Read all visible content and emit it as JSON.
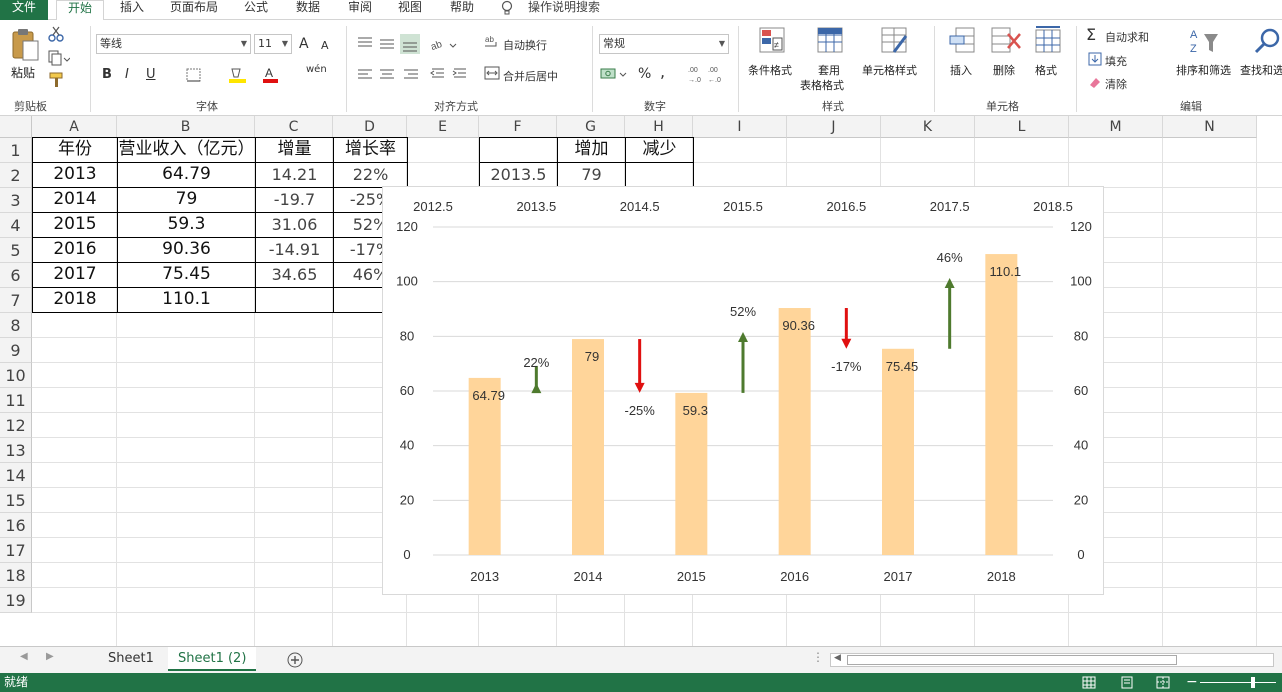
{
  "ribbon_tabs": [
    {
      "label": "文件"
    },
    {
      "label": "开始"
    },
    {
      "label": "插入"
    },
    {
      "label": "页面布局"
    },
    {
      "label": "公式"
    },
    {
      "label": "数据"
    },
    {
      "label": "审阅"
    },
    {
      "label": "视图"
    },
    {
      "label": "帮助"
    }
  ],
  "tell_me": "操作说明搜索",
  "ribbon": {
    "clipboard": {
      "paste": "粘贴",
      "group": "剪贴板"
    },
    "font": {
      "name": "等线",
      "size": "11",
      "group": "字体",
      "bold": "B",
      "italic": "I",
      "underline": "U",
      "grow": "A",
      "shrink": "A",
      "phonetic": "wén"
    },
    "alignment": {
      "wrap": "自动换行",
      "merge": "合并后居中",
      "group": "对齐方式"
    },
    "number": {
      "format": "常规",
      "percent": "%",
      "comma": ",",
      "group": "数字"
    },
    "styles": {
      "conditional": "条件格式",
      "table_format_1": "套用",
      "table_format_2": "表格格式",
      "cell_styles": "单元格样式",
      "group": "样式"
    },
    "cells": {
      "insert": "插入",
      "delete": "删除",
      "format": "格式",
      "group": "单元格"
    },
    "editing": {
      "autosum": "自动求和",
      "fill": "填充",
      "clear": "清除",
      "sort": "排序和筛选",
      "find": "查找和选择",
      "group": "编辑"
    }
  },
  "columns": [
    "A",
    "B",
    "C",
    "D",
    "E",
    "F",
    "G",
    "H",
    "I",
    "J",
    "K",
    "L",
    "M",
    "N"
  ],
  "rows": [
    "1",
    "2",
    "3",
    "4",
    "5",
    "6",
    "7",
    "8",
    "9",
    "10",
    "11",
    "12",
    "13",
    "14",
    "15",
    "16",
    "17",
    "18",
    "19"
  ],
  "table": {
    "header": {
      "year": "年份",
      "revenue": "营业收入（亿元）",
      "delta": "增量",
      "growth": "增长率"
    },
    "data": [
      {
        "year": "2013",
        "revenue": "64.79",
        "delta": "14.21",
        "growth": "22%"
      },
      {
        "year": "2014",
        "revenue": "79",
        "delta": "-19.7",
        "growth": "-25%"
      },
      {
        "year": "2015",
        "revenue": "59.3",
        "delta": "31.06",
        "growth": "52%"
      },
      {
        "year": "2016",
        "revenue": "90.36",
        "delta": "-14.91",
        "growth": "-17%"
      },
      {
        "year": "2017",
        "revenue": "75.45",
        "delta": "34.65",
        "growth": "46%"
      },
      {
        "year": "2018",
        "revenue": "110.1",
        "delta": "",
        "growth": ""
      }
    ],
    "aux_header": {
      "increase": "增加",
      "decrease": "减少"
    },
    "aux_row": {
      "x": "2013.5",
      "increase": "79",
      "decrease": ""
    }
  },
  "chart_data": {
    "type": "bar",
    "categories": [
      "2013",
      "2014",
      "2015",
      "2016",
      "2017",
      "2018"
    ],
    "values": [
      64.79,
      79,
      59.3,
      90.36,
      75.45,
      110.1
    ],
    "value_labels": [
      "64.79",
      "79",
      "59.3",
      "90.36",
      "75.45",
      "110.1"
    ],
    "ylim": [
      0,
      120
    ],
    "yticks": [
      "0",
      "20",
      "40",
      "60",
      "80",
      "100",
      "120"
    ],
    "secondary_xticks": [
      "2012.5",
      "2013.5",
      "2014.5",
      "2015.5",
      "2016.5",
      "2017.5",
      "2018.5"
    ],
    "secondary_xlim": [
      2012.5,
      2018.5
    ],
    "changes": [
      {
        "x": 2013.5,
        "from": 64.79,
        "to": 79,
        "label": "22%",
        "direction": "up"
      },
      {
        "x": 2014.5,
        "from": 79,
        "to": 59.3,
        "label": "-25%",
        "direction": "down"
      },
      {
        "x": 2015.5,
        "from": 59.3,
        "to": 90.36,
        "label": "52%",
        "direction": "up"
      },
      {
        "x": 2016.5,
        "from": 90.36,
        "to": 75.45,
        "label": "-17%",
        "direction": "down"
      },
      {
        "x": 2017.5,
        "from": 75.45,
        "to": 110.1,
        "label": "46%",
        "direction": "up"
      }
    ],
    "bar_color": "#FFD59A",
    "up_color": "#4E7A2E",
    "down_color": "#E01010",
    "grid": true,
    "legend": "none"
  },
  "sheets": [
    {
      "label": "Sheet1"
    },
    {
      "label": "Sheet1 (2)"
    }
  ],
  "status": {
    "ready": "就绪"
  },
  "colors": {
    "accent": "#217346"
  }
}
